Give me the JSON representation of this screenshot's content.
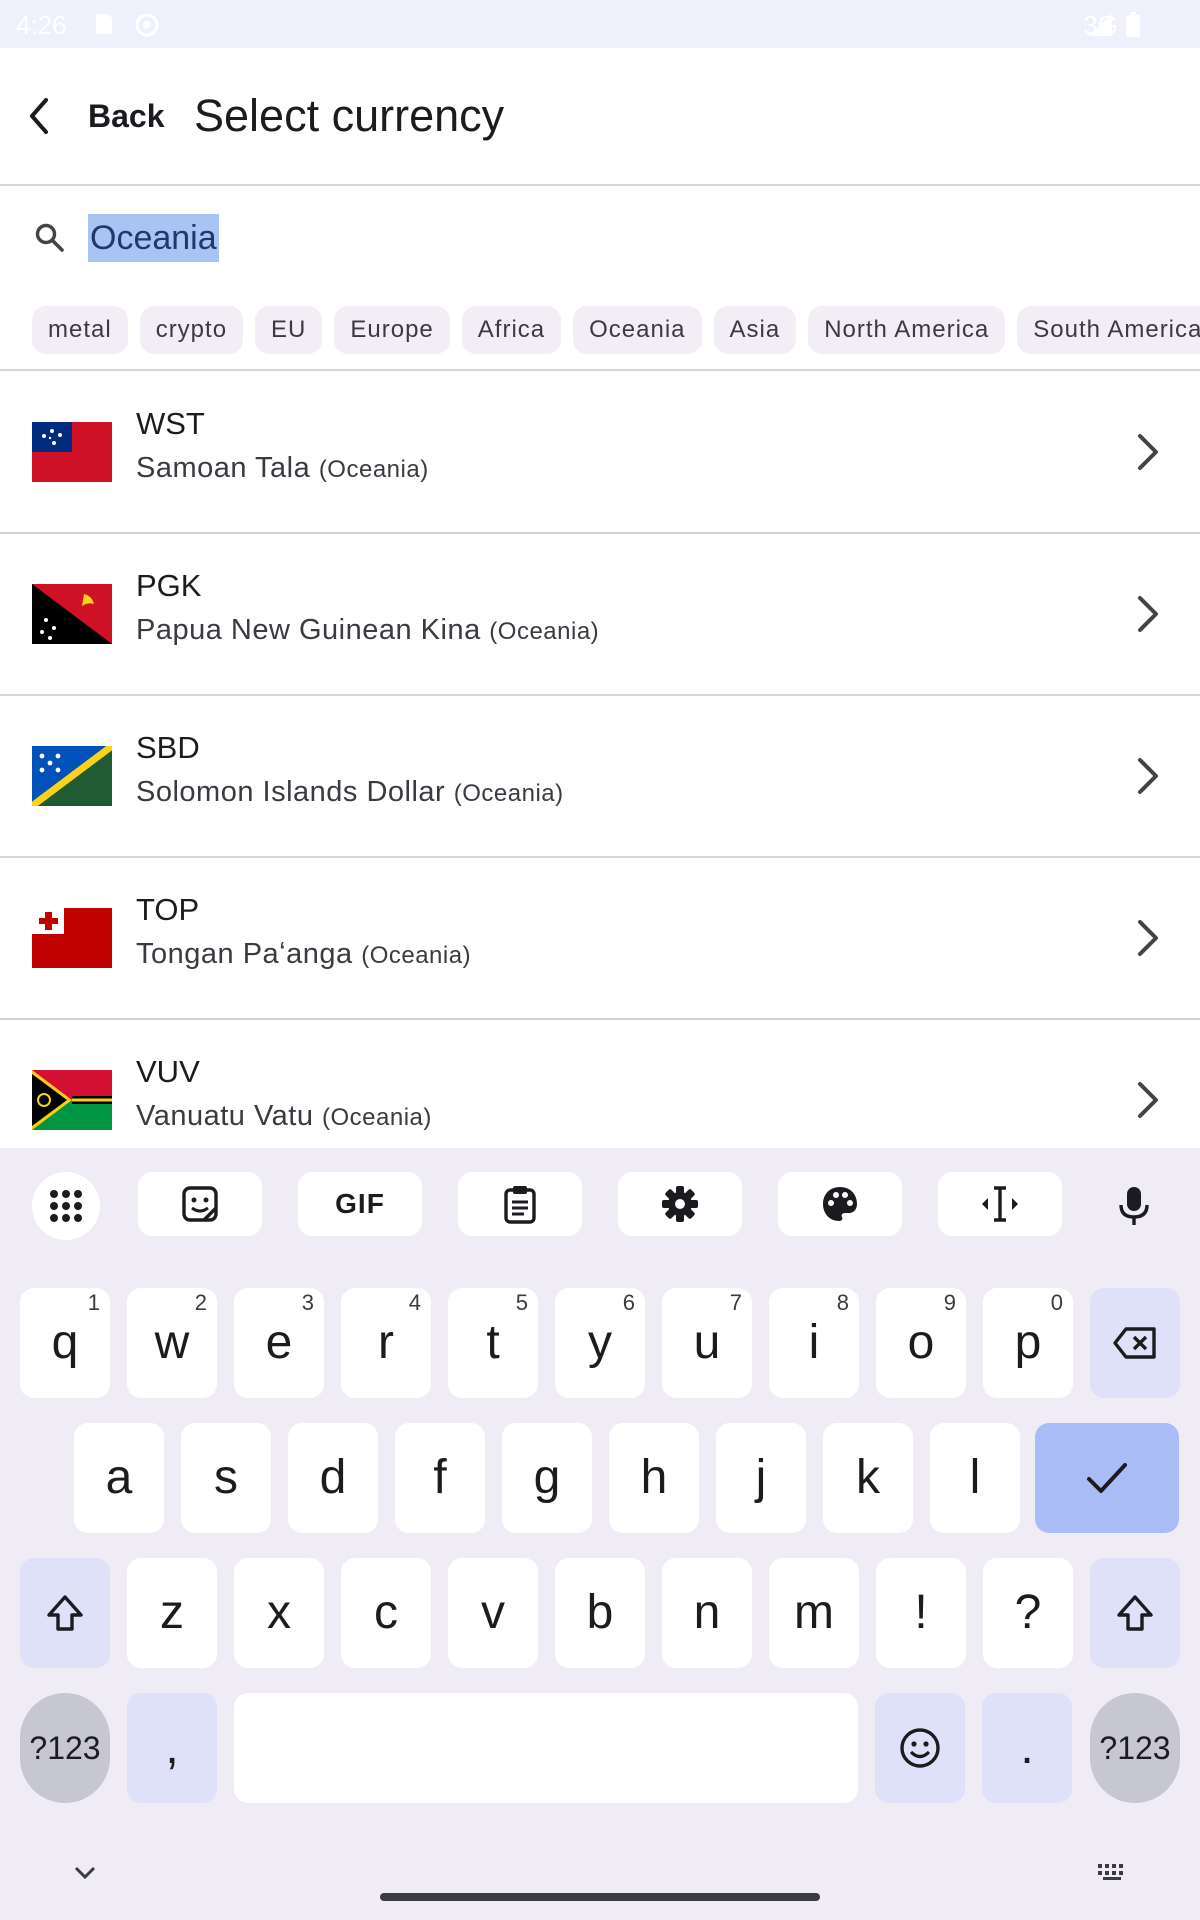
{
  "status_bar": {
    "time": "4:26",
    "network": "3G"
  },
  "app_bar": {
    "back_label": "Back",
    "title": "Select currency"
  },
  "search": {
    "value": "Oceania"
  },
  "filter_chips": [
    "metal",
    "crypto",
    "EU",
    "Europe",
    "Africa",
    "Oceania",
    "Asia",
    "North America",
    "South America"
  ],
  "currencies": [
    {
      "code": "WST",
      "name": "Samoan Tala",
      "region": "(Oceania)",
      "flag": "samoa-flag"
    },
    {
      "code": "PGK",
      "name": "Papua New Guinean Kina",
      "region": "(Oceania)",
      "flag": "papua-new-guinea-flag"
    },
    {
      "code": "SBD",
      "name": "Solomon Islands Dollar",
      "region": "(Oceania)",
      "flag": "solomon-islands-flag"
    },
    {
      "code": "TOP",
      "name": "Tongan Paʻanga",
      "region": "(Oceania)",
      "flag": "tonga-flag"
    },
    {
      "code": "VUV",
      "name": "Vanuatu Vatu",
      "region": "(Oceania)",
      "flag": "vanuatu-flag"
    }
  ],
  "keyboard": {
    "toolbar": [
      "apps-icon",
      "sticker-icon",
      "gif-icon",
      "clipboard-icon",
      "settings-icon",
      "palette-icon",
      "text-cursor-icon",
      "microphone-icon"
    ],
    "gif_label": "GIF",
    "row1": [
      {
        "key": "q",
        "hint": "1"
      },
      {
        "key": "w",
        "hint": "2"
      },
      {
        "key": "e",
        "hint": "3"
      },
      {
        "key": "r",
        "hint": "4"
      },
      {
        "key": "t",
        "hint": "5"
      },
      {
        "key": "y",
        "hint": "6"
      },
      {
        "key": "u",
        "hint": "7"
      },
      {
        "key": "i",
        "hint": "8"
      },
      {
        "key": "o",
        "hint": "9"
      },
      {
        "key": "p",
        "hint": "0"
      }
    ],
    "row2": [
      "a",
      "s",
      "d",
      "f",
      "g",
      "h",
      "j",
      "k",
      "l"
    ],
    "row3": [
      "z",
      "x",
      "c",
      "v",
      "b",
      "n",
      "m",
      "!",
      "?"
    ],
    "symbols_label": "?123",
    "comma": ",",
    "period": "."
  },
  "colors": {
    "accent": "#aabcf5",
    "selection": "#a9c3f2",
    "keyboard_bg": "#efecf6"
  }
}
